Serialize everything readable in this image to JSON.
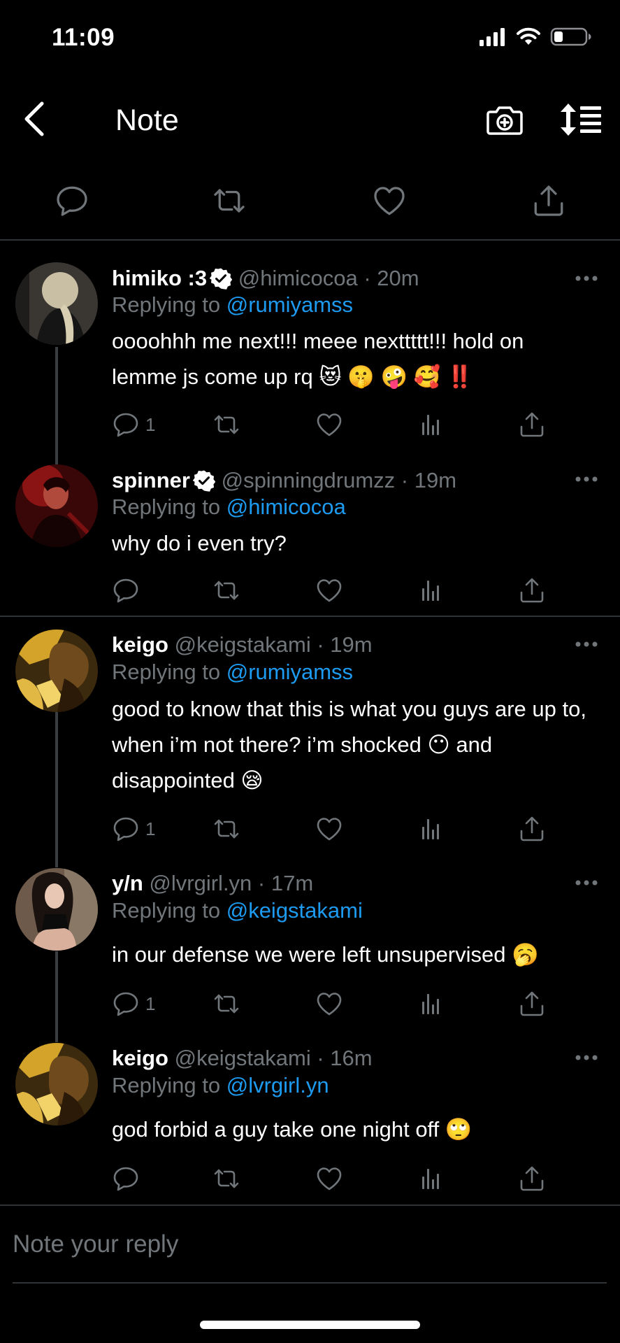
{
  "status_bar": {
    "time": "11:09"
  },
  "nav": {
    "title": "Note"
  },
  "reply_input": {
    "placeholder": "Note your reply"
  },
  "colors": {
    "background": "#000000",
    "accent": "#1d9bf0",
    "muted": "#71767b",
    "verified": "#ffffff"
  },
  "tweets": [
    {
      "name": "himiko :3",
      "verified": true,
      "handle": "@himicocoa",
      "time": "· 20m",
      "replying_prefix": "Replying to ",
      "replying_to": "@rumiyamss",
      "text": "oooohhh me next!!! meee nexttttt!!! hold on lemme js come up rq 😻 🤫 🤪 🥰 ‼️",
      "reply_count": "1"
    },
    {
      "name": "spinner",
      "verified": true,
      "handle": "@spinningdrumzz",
      "time": "· 19m",
      "replying_prefix": "Replying to ",
      "replying_to": "@himicocoa",
      "text": "why do i even try?",
      "reply_count": ""
    },
    {
      "name": "keigo",
      "verified": false,
      "handle": "@keigstakami",
      "time": "· 19m",
      "replying_prefix": "Replying to ",
      "replying_to": "@rumiyamss",
      "text": "good to know that this is what you guys are up to, when i’m not there? i’m shocked 😶 and disappointed 😪",
      "reply_count": "1"
    },
    {
      "name": "y/n",
      "verified": false,
      "handle": "@lvrgirl.yn",
      "time": "· 17m",
      "replying_prefix": "Replying to ",
      "replying_to": "@keigstakami",
      "text": "in our defense we were left unsupervised 🥱",
      "reply_count": "1"
    },
    {
      "name": "keigo",
      "verified": false,
      "handle": "@keigstakami",
      "time": "· 16m",
      "replying_prefix": "Replying to ",
      "replying_to": "@lvrgirl.yn",
      "text": "god forbid a guy take one night off 🙄",
      "reply_count": ""
    }
  ]
}
